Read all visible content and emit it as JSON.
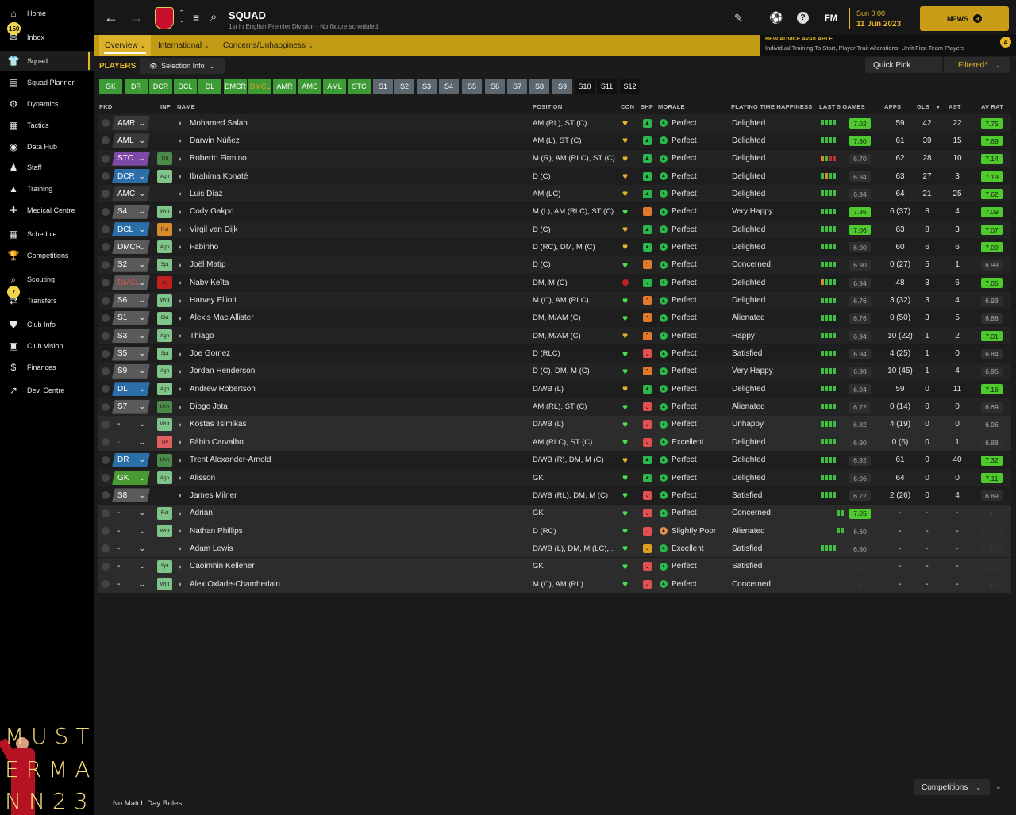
{
  "sidebar": {
    "items": [
      {
        "label": "Home",
        "icon": "home-icon",
        "glyph": "⌂"
      },
      {
        "label": "Inbox",
        "icon": "inbox-icon",
        "glyph": "✉",
        "badge": "150"
      },
      {
        "label": "Squad",
        "icon": "squad-icon",
        "glyph": "👕",
        "active": true
      },
      {
        "label": "Squad Planner",
        "icon": "planner-icon",
        "glyph": "▤"
      },
      {
        "label": "Dynamics",
        "icon": "dynamics-icon",
        "glyph": "⚙"
      },
      {
        "label": "Tactics",
        "icon": "tactics-icon",
        "glyph": "▦"
      },
      {
        "label": "Data Hub",
        "icon": "data-hub-icon",
        "glyph": "◉"
      },
      {
        "label": "Staff",
        "icon": "staff-icon",
        "glyph": "♟"
      },
      {
        "label": "Training",
        "icon": "training-icon",
        "glyph": "▲"
      },
      {
        "label": "Medical Centre",
        "icon": "medical-icon",
        "glyph": "✚"
      },
      {
        "label": "Schedule",
        "icon": "schedule-icon",
        "glyph": "▦"
      },
      {
        "label": "Competitions",
        "icon": "trophy-icon",
        "glyph": "🏆"
      },
      {
        "label": "Scouting",
        "icon": "scouting-icon",
        "glyph": "⌕"
      },
      {
        "label": "Transfers",
        "icon": "transfers-icon",
        "glyph": "⇄",
        "badge": "7"
      },
      {
        "label": "Club Info",
        "icon": "club-info-icon",
        "glyph": "⛊"
      },
      {
        "label": "Club Vision",
        "icon": "club-vision-icon",
        "glyph": "▣"
      },
      {
        "label": "Finances",
        "icon": "finances-icon",
        "glyph": "$"
      },
      {
        "label": "Dev. Centre",
        "icon": "dev-centre-icon",
        "glyph": "↗"
      }
    ],
    "logo_text": [
      "MUST",
      "ERMA",
      "NN23"
    ]
  },
  "header": {
    "title": "SQUAD",
    "subtitle": "1st in English Premier Division - No fixture scheduled.",
    "fm": "FM",
    "date_day": "Sun 0:00",
    "date": "11 Jun 2023",
    "news_label": "NEWS"
  },
  "subnav": {
    "tabs": [
      "Overview",
      "International",
      "Concerns/Unhappiness"
    ],
    "advice_title": "NEW ADVICE AVAILABLE",
    "advice_text": "Individual Training To Start, Player Trait Alterations, Unfit First Team Players",
    "advice_count": "4"
  },
  "toolbar": {
    "players_label": "PLAYERS",
    "selection_info": "Selection Info",
    "quick_pick": "Quick Pick",
    "filtered": "Filtered*"
  },
  "positions": [
    {
      "label": "GK",
      "color": "#3d9b35"
    },
    {
      "label": "DR",
      "color": "#3d9b35"
    },
    {
      "label": "DCR",
      "color": "#3d9b35"
    },
    {
      "label": "DCL",
      "color": "#3d9b35"
    },
    {
      "label": "DL",
      "color": "#3d9b35"
    },
    {
      "label": "DMCR",
      "color": "#3d9b35"
    },
    {
      "label": "DMCL",
      "color": "#3d9b35",
      "text": "#e0a020"
    },
    {
      "label": "AMR",
      "color": "#3d9b35"
    },
    {
      "label": "AMC",
      "color": "#3d9b35"
    },
    {
      "label": "AML",
      "color": "#3d9b35"
    },
    {
      "label": "STC",
      "color": "#3d9b35"
    },
    {
      "label": "S1",
      "color": "#5c6770"
    },
    {
      "label": "S2",
      "color": "#5c6770"
    },
    {
      "label": "S3",
      "color": "#5c6770"
    },
    {
      "label": "S4",
      "color": "#5c6770"
    },
    {
      "label": "S5",
      "color": "#5c6770"
    },
    {
      "label": "S6",
      "color": "#5c6770"
    },
    {
      "label": "S7",
      "color": "#5c6770"
    },
    {
      "label": "S8",
      "color": "#5c6770"
    },
    {
      "label": "S9",
      "color": "#5c6770"
    },
    {
      "label": "S10",
      "color": "#111111"
    },
    {
      "label": "S11",
      "color": "#111111"
    },
    {
      "label": "S12",
      "color": "#111111"
    }
  ],
  "columns": [
    "PKD",
    "INF",
    "NAME",
    "POSITION",
    "CON",
    "SHP",
    "MORALE",
    "PLAYING TIME HAPPINESS",
    "LAST 5 GAMES",
    "APPS",
    "GLS",
    "AST",
    "AV RAT"
  ],
  "players": [
    {
      "sel": "AMR",
      "selColor": "#3a3a3a",
      "inf": "",
      "name": "Mohamed Salah",
      "pos": "AM (RL), ST (C)",
      "con": "heart-gold",
      "shp": "up",
      "morale": "Perfect",
      "happy": "Delighted",
      "last": "gggg",
      "rating": "7.02",
      "ratingStyle": "g",
      "apps": "59",
      "gls": "42",
      "ast": "22",
      "av": "7.75",
      "avStyle": "g"
    },
    {
      "sel": "AML",
      "selColor": "#3a3a3a",
      "inf": "",
      "name": "Darwin Núñez",
      "pos": "AM (L), ST (C)",
      "con": "heart-gold",
      "shp": "up",
      "morale": "Perfect",
      "happy": "Delighted",
      "last": "gggg",
      "rating": "7.80",
      "ratingStyle": "g",
      "apps": "61",
      "gls": "39",
      "ast": "15",
      "av": "7.69",
      "avStyle": "g"
    },
    {
      "sel": "STC",
      "selColor": "#7d4aa8",
      "inf": "Trn",
      "infColor": "#4a8a4a",
      "name": "Roberto Firmino",
      "pos": "M (R), AM (RLC), ST (C)",
      "con": "heart-gold",
      "shp": "up",
      "morale": "Perfect",
      "happy": "Delighted",
      "last": "ogrr",
      "rating": "6.70",
      "ratingStyle": "d",
      "apps": "62",
      "gls": "28",
      "ast": "10",
      "av": "7.14",
      "avStyle": "g"
    },
    {
      "sel": "DCR",
      "selColor": "#2c6ea8",
      "inf": "Agn",
      "infColor": "#7fc48a",
      "name": "Ibrahima Konaté",
      "pos": "D (C)",
      "con": "heart-gold",
      "shp": "up",
      "morale": "Perfect",
      "happy": "Delighted",
      "last": "gogg",
      "rating": "6.94",
      "ratingStyle": "d",
      "apps": "63",
      "gls": "27",
      "ast": "3",
      "av": "7.19",
      "avStyle": "g"
    },
    {
      "sel": "AMC",
      "selColor": "#3a3a3a",
      "inf": "",
      "name": "Luis Díaz",
      "pos": "AM (LC)",
      "con": "heart-gold",
      "shp": "up",
      "morale": "Perfect",
      "happy": "Delighted",
      "last": "gggg",
      "rating": "6.94",
      "ratingStyle": "d",
      "apps": "64",
      "gls": "21",
      "ast": "25",
      "av": "7.62",
      "avStyle": "g"
    },
    {
      "sel": "S4",
      "selColor": "#5a5a5a",
      "inf": "Wnt",
      "infColor": "#7fc48a",
      "name": "Cody Gakpo",
      "pos": "M (L), AM (RLC), ST (C)",
      "con": "heart-green",
      "shp": "mid",
      "morale": "Perfect",
      "happy": "Very Happy",
      "last": "gggg",
      "rating": "7.36",
      "ratingStyle": "g",
      "apps": "6 (37)",
      "gls": "8",
      "ast": "4",
      "av": "7.09",
      "avStyle": "g"
    },
    {
      "sel": "DCL",
      "selColor": "#2c6ea8",
      "inf": "Rst",
      "infColor": "#d98b2a",
      "name": "Virgil van Dijk",
      "pos": "D (C)",
      "con": "heart-gold",
      "shp": "up",
      "morale": "Perfect",
      "happy": "Delighted",
      "last": "gggg",
      "rating": "7.06",
      "ratingStyle": "g",
      "apps": "63",
      "gls": "8",
      "ast": "3",
      "av": "7.07",
      "avStyle": "g"
    },
    {
      "sel": "DMCR",
      "selColor": "#5a5a5a",
      "inf": "Agn",
      "infColor": "#7fc48a",
      "name": "Fabinho",
      "pos": "D (RC), DM, M (C)",
      "con": "heart-gold",
      "shp": "up",
      "morale": "Perfect",
      "happy": "Delighted",
      "last": "gggg",
      "rating": "6.90",
      "ratingStyle": "d",
      "apps": "60",
      "gls": "6",
      "ast": "6",
      "av": "7.09",
      "avStyle": "g"
    },
    {
      "sel": "S2",
      "selColor": "#5a5a5a",
      "inf": "Spt",
      "infColor": "#7fc48a",
      "name": "Joël Matip",
      "pos": "D (C)",
      "con": "heart-green",
      "shp": "mid",
      "morale": "Perfect",
      "happy": "Concerned",
      "last": "gggg",
      "rating": "6.90",
      "ratingStyle": "d",
      "apps": "0 (27)",
      "gls": "5",
      "ast": "1",
      "av": "6.99",
      "avStyle": "d"
    },
    {
      "sel": "DMCL",
      "selColor": "#5a5a5a",
      "selText": "#e05050",
      "inf": "Inj",
      "infColor": "#c02020",
      "name": "Naby Keïta",
      "pos": "DM, M (C)",
      "con": "dot-red",
      "shp": "down",
      "morale": "Perfect",
      "happy": "Delighted",
      "last": "oggg",
      "rating": "6.94",
      "ratingStyle": "d",
      "apps": "48",
      "gls": "3",
      "ast": "6",
      "av": "7.05",
      "avStyle": "g"
    },
    {
      "sel": "S6",
      "selColor": "#5a5a5a",
      "inf": "Wnt",
      "infColor": "#7fc48a",
      "name": "Harvey Elliott",
      "pos": "M (C), AM (RLC)",
      "con": "heart-green",
      "shp": "mid",
      "morale": "Perfect",
      "happy": "Delighted",
      "last": "gggg",
      "rating": "6.76",
      "ratingStyle": "d",
      "apps": "3 (32)",
      "gls": "3",
      "ast": "4",
      "av": "6.93",
      "avStyle": "d"
    },
    {
      "sel": "S1",
      "selColor": "#5a5a5a",
      "inf": "Bkt",
      "infColor": "#7fc48a",
      "name": "Alexis Mac Allister",
      "pos": "DM, M/AM (C)",
      "con": "heart-green",
      "shp": "mid",
      "morale": "Perfect",
      "happy": "Alienated",
      "last": "gggg",
      "rating": "6.76",
      "ratingStyle": "d",
      "apps": "0 (50)",
      "gls": "3",
      "ast": "5",
      "av": "6.88",
      "avStyle": "d"
    },
    {
      "sel": "S3",
      "selColor": "#5a5a5a",
      "inf": "Agn",
      "infColor": "#7fc48a",
      "name": "Thiago",
      "pos": "DM, M/AM (C)",
      "con": "heart-gold",
      "shp": "mid",
      "morale": "Perfect",
      "happy": "Happy",
      "last": "gggg",
      "rating": "6.94",
      "ratingStyle": "d",
      "apps": "10 (22)",
      "gls": "1",
      "ast": "2",
      "av": "7.01",
      "avStyle": "g"
    },
    {
      "sel": "S5",
      "selColor": "#5a5a5a",
      "inf": "Spt",
      "infColor": "#7fc48a",
      "name": "Joe Gomez",
      "pos": "D (RLC)",
      "con": "heart-green",
      "shp": "low",
      "morale": "Perfect",
      "happy": "Satisfied",
      "last": "gggg",
      "rating": "6.94",
      "ratingStyle": "d",
      "apps": "4 (25)",
      "gls": "1",
      "ast": "0",
      "av": "6.84",
      "avStyle": "d"
    },
    {
      "sel": "S9",
      "selColor": "#5a5a5a",
      "inf": "Agn",
      "infColor": "#7fc48a",
      "name": "Jordan Henderson",
      "pos": "D (C), DM, M (C)",
      "con": "heart-green",
      "shp": "mid",
      "morale": "Perfect",
      "happy": "Very Happy",
      "last": "gggg",
      "rating": "6.98",
      "ratingStyle": "d",
      "apps": "10 (45)",
      "gls": "1",
      "ast": "4",
      "av": "6.95",
      "avStyle": "d"
    },
    {
      "sel": "DL",
      "selColor": "#2c6ea8",
      "inf": "Agn",
      "infColor": "#7fc48a",
      "name": "Andrew Robertson",
      "pos": "D/WB (L)",
      "con": "heart-gold",
      "shp": "up",
      "morale": "Perfect",
      "happy": "Delighted",
      "last": "gggg",
      "rating": "6.94",
      "ratingStyle": "d",
      "apps": "59",
      "gls": "0",
      "ast": "11",
      "av": "7.16",
      "avStyle": "g"
    },
    {
      "sel": "S7",
      "selColor": "#5a5a5a",
      "inf": "Unh",
      "infColor": "#4a8a4a",
      "name": "Diogo Jota",
      "pos": "AM (RL), ST (C)",
      "con": "heart-green",
      "shp": "low",
      "morale": "Perfect",
      "happy": "Alienated",
      "last": "gggg",
      "rating": "6.72",
      "ratingStyle": "d",
      "apps": "0 (14)",
      "gls": "0",
      "ast": "0",
      "av": "6.69",
      "avStyle": "d"
    },
    {
      "sel": "-",
      "selColor": "#2c2c2c",
      "inf": "Wnt",
      "infColor": "#7fc48a",
      "name": "Kostas Tsimikas",
      "pos": "D/WB (L)",
      "con": "heart-green",
      "shp": "low",
      "morale": "Perfect",
      "happy": "Unhappy",
      "last": "gggg",
      "rating": "6.82",
      "ratingStyle": "d",
      "apps": "4 (19)",
      "gls": "0",
      "ast": "0",
      "av": "6.96",
      "avStyle": "d",
      "grey": true
    },
    {
      "sel": "-",
      "selColor": "#2c2c2c",
      "selText": "#e05050",
      "inf": "Trv",
      "infColor": "#e06060",
      "name": "Fábio Carvalho",
      "pos": "AM (RLC), ST (C)",
      "con": "heart-green",
      "shp": "low",
      "morale": "Excellent",
      "happy": "Delighted",
      "last": "gggg",
      "rating": "6.90",
      "ratingStyle": "d",
      "apps": "0 (6)",
      "gls": "0",
      "ast": "1",
      "av": "6.88",
      "avStyle": "d",
      "grey": true
    },
    {
      "sel": "DR",
      "selColor": "#2c6ea8",
      "inf": "Unh",
      "infColor": "#4a8a4a",
      "name": "Trent Alexander-Arnold",
      "pos": "D/WB (R), DM, M (C)",
      "con": "heart-gold",
      "shp": "up",
      "morale": "Perfect",
      "happy": "Delighted",
      "last": "gggg",
      "rating": "6.92",
      "ratingStyle": "d",
      "apps": "61",
      "gls": "0",
      "ast": "40",
      "av": "7.32",
      "avStyle": "g"
    },
    {
      "sel": "GK",
      "selColor": "#4a9a34",
      "inf": "Agn",
      "infColor": "#7fc48a",
      "name": "Alisson",
      "pos": "GK",
      "con": "heart-green",
      "shp": "up",
      "morale": "Perfect",
      "happy": "Delighted",
      "last": "gggg",
      "rating": "6.96",
      "ratingStyle": "d",
      "apps": "64",
      "gls": "0",
      "ast": "0",
      "av": "7.11",
      "avStyle": "g"
    },
    {
      "sel": "S8",
      "selColor": "#5a5a5a",
      "inf": "",
      "name": "James Milner",
      "pos": "D/WB (RL), DM, M (C)",
      "con": "heart-green",
      "shp": "low",
      "morale": "Perfect",
      "happy": "Satisfied",
      "last": "gggg",
      "rating": "6.72",
      "ratingStyle": "d",
      "apps": "2 (26)",
      "gls": "0",
      "ast": "4",
      "av": "6.89",
      "avStyle": "d"
    },
    {
      "sel": "-",
      "selColor": "#2c2c2c",
      "inf": "Rst",
      "infColor": "#7fc48a",
      "name": "Adrián",
      "pos": "GK",
      "con": "heart-green",
      "shp": "low",
      "morale": "Perfect",
      "happy": "Concerned",
      "last": "gg",
      "rating": "7.05",
      "ratingStyle": "g",
      "apps": "-",
      "gls": "-",
      "ast": "-",
      "av": "-",
      "avStyle": "n",
      "grey": true
    },
    {
      "sel": "-",
      "selColor": "#2c2c2c",
      "inf": "Wnt",
      "infColor": "#7fc48a",
      "name": "Nathan Phillips",
      "pos": "D (RC)",
      "con": "heart-green",
      "shp": "low",
      "morale": "Slightly Poor",
      "moraleColor": "#e0904a",
      "happy": "Alienated",
      "last": "gg",
      "rating": "6.60",
      "ratingStyle": "d",
      "apps": "-",
      "gls": "-",
      "ast": "-",
      "av": "-",
      "avStyle": "n",
      "grey": true
    },
    {
      "sel": "-",
      "selColor": "#2c2c2c",
      "inf": "",
      "name": "Adam Lewis",
      "pos": "D/WB (L), DM, M (LC),...",
      "con": "heart-green",
      "shp": "mid2",
      "morale": "Excellent",
      "happy": "Satisfied",
      "last": "gggg",
      "rating": "6.80",
      "ratingStyle": "d",
      "apps": "-",
      "gls": "-",
      "ast": "-",
      "av": "-",
      "avStyle": "n",
      "grey": true
    },
    {
      "sel": "-",
      "selColor": "#2c2c2c",
      "inf": "Spt",
      "infColor": "#7fc48a",
      "name": "Caoimhin Kelleher",
      "pos": "GK",
      "con": "heart-green",
      "shp": "low",
      "morale": "Perfect",
      "happy": "Satisfied",
      "last": "",
      "rating": "-",
      "ratingStyle": "n",
      "apps": "-",
      "gls": "-",
      "ast": "-",
      "av": "-",
      "avStyle": "n",
      "grey": true
    },
    {
      "sel": "-",
      "selColor": "#2c2c2c",
      "inf": "Wnt",
      "infColor": "#7fc48a",
      "name": "Alex Oxlade-Chamberlain",
      "pos": "M (C), AM (RL)",
      "con": "heart-green",
      "shp": "low",
      "morale": "Perfect",
      "happy": "Concerned",
      "last": "",
      "rating": "-",
      "ratingStyle": "n",
      "apps": "-",
      "gls": "-",
      "ast": "-",
      "av": "-",
      "avStyle": "n",
      "grey": true
    }
  ],
  "footer": {
    "rules": "No Match Day Rules",
    "competitions": "Competitions"
  }
}
